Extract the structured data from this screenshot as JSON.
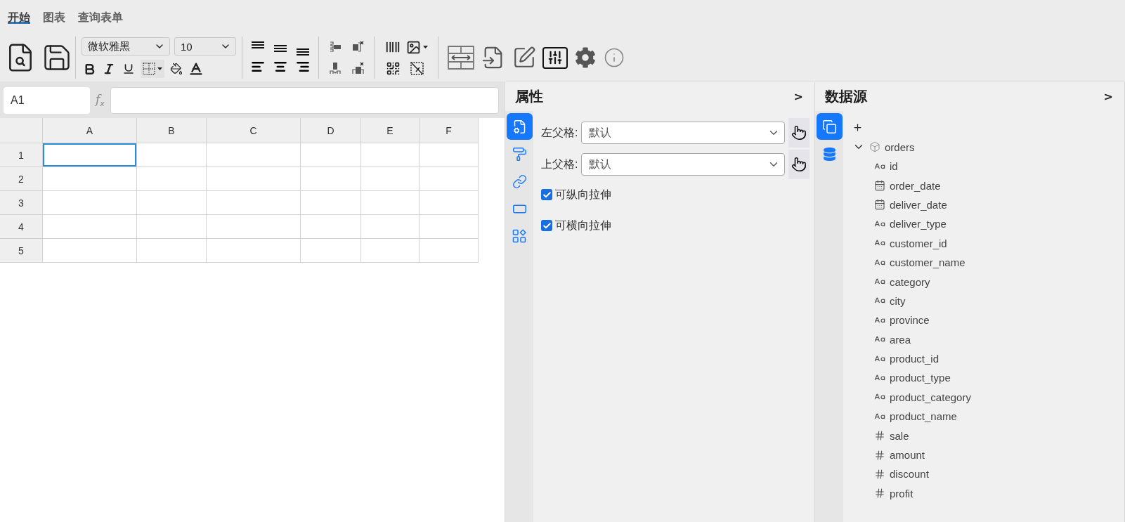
{
  "tabs": [
    {
      "label": "开始",
      "selected": true
    },
    {
      "label": "图表",
      "selected": false
    },
    {
      "label": "查询表单",
      "selected": false
    }
  ],
  "toolbar": {
    "font_family": "微软雅黑",
    "font_size": "10"
  },
  "formula_bar": {
    "cell_reference": "A1",
    "function_label": "f$_{x}$"
  },
  "sheet": {
    "columns": [
      "A",
      "B",
      "C",
      "D",
      "E",
      "F"
    ],
    "rows": [
      {
        "label": "1",
        "cells": [
          {
            "selected": true
          },
          {
            "selected": false
          },
          {
            "selected": false
          },
          {
            "selected": false
          },
          {
            "selected": false
          },
          {
            "selected": false
          }
        ]
      },
      {
        "label": "2",
        "cells": [
          {
            "selected": false
          },
          {
            "selected": false
          },
          {
            "selected": false
          },
          {
            "selected": false
          },
          {
            "selected": false
          },
          {
            "selected": false
          }
        ]
      },
      {
        "label": "3",
        "cells": [
          {
            "selected": false
          },
          {
            "selected": false
          },
          {
            "selected": false
          },
          {
            "selected": false
          },
          {
            "selected": false
          },
          {
            "selected": false
          }
        ]
      },
      {
        "label": "4",
        "cells": [
          {
            "selected": false
          },
          {
            "selected": false
          },
          {
            "selected": false
          },
          {
            "selected": false
          },
          {
            "selected": false
          },
          {
            "selected": false
          }
        ]
      },
      {
        "label": "5",
        "cells": [
          {
            "selected": false
          },
          {
            "selected": false
          },
          {
            "selected": false
          },
          {
            "selected": false
          },
          {
            "selected": false
          },
          {
            "selected": false
          }
        ]
      }
    ]
  },
  "properties_panel": {
    "title": "属性",
    "collapse": ">",
    "side_tabs": [
      {
        "kind": "cell",
        "selected": true
      },
      {
        "kind": "style",
        "selected": false
      },
      {
        "kind": "link",
        "selected": false
      },
      {
        "kind": "frame",
        "selected": false
      },
      {
        "kind": "widgets",
        "selected": false
      }
    ],
    "selects": [
      {
        "label": "左父格:",
        "value": "默认"
      },
      {
        "label": "上父格:",
        "value": "默认"
      }
    ],
    "checkboxes": [
      {
        "label": "可纵向拉伸",
        "checked": true
      },
      {
        "label": "可横向拉伸",
        "checked": true
      }
    ]
  },
  "datasource_panel": {
    "title": "数据源",
    "collapse": ">",
    "side_tabs": [
      {
        "kind": "datasets",
        "selected": true
      },
      {
        "kind": "database",
        "selected": false
      }
    ],
    "tree": [
      {
        "label": "orders",
        "expanded": true,
        "children": [
          {
            "label": "id",
            "kind": "text"
          },
          {
            "label": "order_date",
            "kind": "date"
          },
          {
            "label": "deliver_date",
            "kind": "date"
          },
          {
            "label": "deliver_type",
            "kind": "text"
          },
          {
            "label": "customer_id",
            "kind": "text"
          },
          {
            "label": "customer_name",
            "kind": "text"
          },
          {
            "label": "category",
            "kind": "text"
          },
          {
            "label": "city",
            "kind": "text"
          },
          {
            "label": "province",
            "kind": "text"
          },
          {
            "label": "area",
            "kind": "text"
          },
          {
            "label": "product_id",
            "kind": "text"
          },
          {
            "label": "product_type",
            "kind": "text"
          },
          {
            "label": "product_category",
            "kind": "text"
          },
          {
            "label": "product_name",
            "kind": "text"
          },
          {
            "label": "sale",
            "kind": "number"
          },
          {
            "label": "amount",
            "kind": "number"
          },
          {
            "label": "discount",
            "kind": "number"
          },
          {
            "label": "profit",
            "kind": "number"
          }
        ]
      }
    ]
  }
}
